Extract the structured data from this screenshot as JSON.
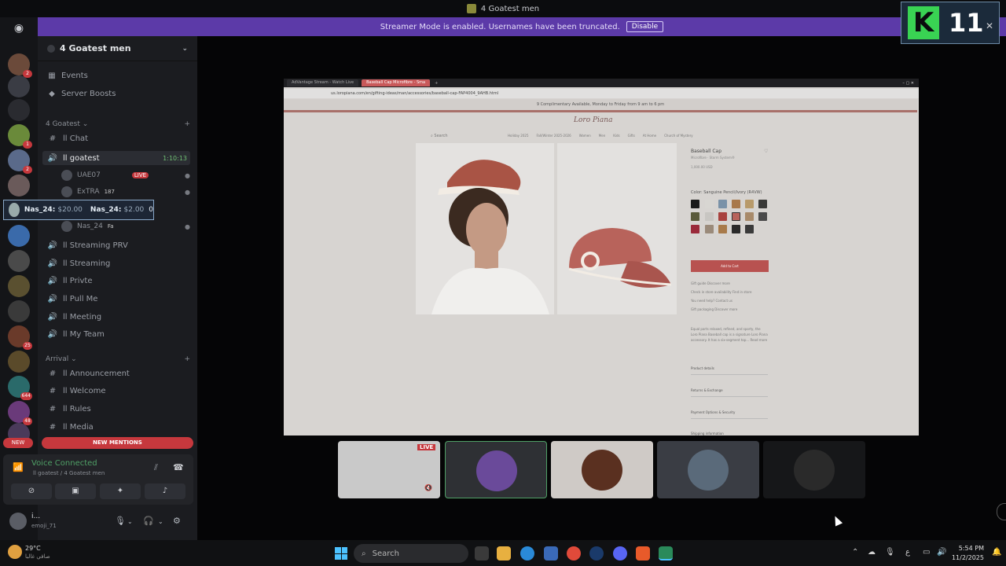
{
  "window": {
    "title": "4 Goatest men"
  },
  "banner": {
    "text": "Streamer Mode is enabled. Usernames have been truncated.",
    "button": "Disable"
  },
  "server": {
    "name": "4 Goatest men"
  },
  "menu": {
    "events": "Events",
    "boosts": "Server Boosts"
  },
  "categories": {
    "goatest": "4 Goatest",
    "arrival": "Arrival"
  },
  "channels": {
    "chat": "ll Chat",
    "goatest": "ll goatest",
    "goatest_timer": "1:10:13",
    "streaming_prv": "ll Streaming PRV",
    "streaming": "ll Streaming",
    "privte": "ll Privte",
    "pull_me": "ll Pull Me",
    "meeting": "ll Meeting",
    "my_team": "ll My Team",
    "announcement": "ll Announcement",
    "welcome": "ll Welcome",
    "rules": "ll Rules",
    "media": "ll Media"
  },
  "voice_users": [
    {
      "name": "UAE07",
      "badge": "LIVE"
    },
    {
      "name": "ExTRA",
      "badge": "187"
    },
    {
      "name": "Nas_24",
      "badge": "Fa"
    }
  ],
  "overlay": {
    "left_name": "Nas_24:",
    "left_value": "$20.00",
    "right_name": "Nas_24:",
    "right_value": "$2.00",
    "tail": "0"
  },
  "mentions": {
    "new": "NEW",
    "new_mentions": "NEW MENTIONS"
  },
  "voice": {
    "status": "Voice Connected",
    "channel": "ll goatest / 4 Goatest men"
  },
  "user": {
    "name": "i...",
    "status": "emoji_71"
  },
  "k11": {
    "letter": "K",
    "number": "11"
  },
  "browser": {
    "tab1": "AdVantage Stream - Watch Live",
    "tab2": "Baseball Cap Microfibre - Sma",
    "address": "us.loropiana.com/en/gifting-ideas/man/accessories/baseball-cap-FAP4004_9AHB.html",
    "promo": "9 Complimentary Available, Monday to Friday from 9 am to 6 pm",
    "logo": "Loro Piana",
    "search": "Search",
    "nav": [
      "Holiday 2025",
      "Fall/Winter 2025-2026",
      "Women",
      "Men",
      "Kids",
      "Gifts",
      "At Home",
      "Church of Mystery"
    ],
    "product_title": "Baseball Cap",
    "product_sub": "Microfibre · Storm System®",
    "product_price": "1,000.00 USD",
    "color_label": "Color: Sanguine Pencil/Ivory (R4VW)",
    "add_to_cart": "Add to Cart",
    "info": [
      "Gift guide   Discover more",
      "Check in store availability   Find in store",
      "You need help?   Contact us",
      "Gift packaging   Discover more"
    ],
    "description": "Equal parts relaxed, refined, and sporty, the Loro Piana Baseball cap is a signature Loro Piana accessory. It has a six-segment top... Read more",
    "accordion": [
      "Product details",
      "Returns & Exchange",
      "Payment Options & Security",
      "Shipping information"
    ]
  },
  "thumb": {
    "live": "LIVE"
  },
  "taskbar": {
    "temp": "29°C",
    "weather": "صافي غالبا",
    "search": "Search",
    "time": "5:54 PM",
    "date": "11/2/2025"
  },
  "colors": {
    "accent": "#5c3aa8",
    "live": "#c6383d",
    "voice": "#4fa066",
    "cart": "#b85250"
  }
}
